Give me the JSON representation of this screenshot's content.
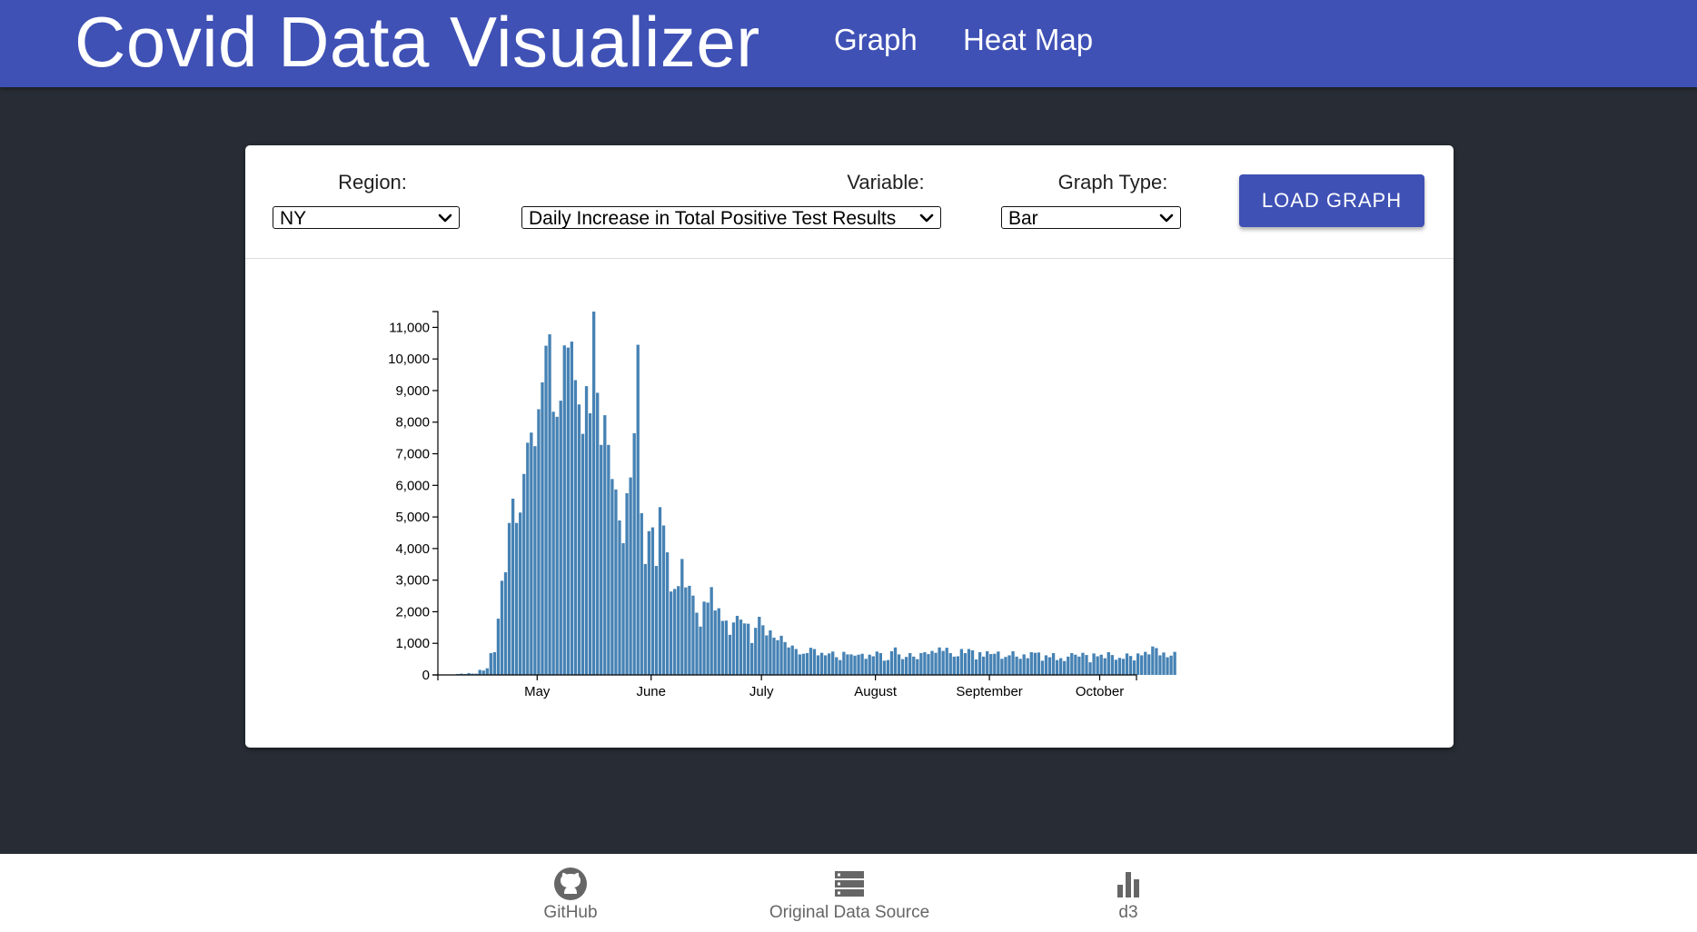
{
  "header": {
    "title": "Covid Data Visualizer",
    "nav": [
      {
        "label": "Graph"
      },
      {
        "label": "Heat Map"
      }
    ]
  },
  "controls": {
    "region": {
      "label": "Region:",
      "value": "NY"
    },
    "variable": {
      "label": "Variable:",
      "value": "Daily Increase in Total Positive Test Results"
    },
    "graph_type": {
      "label": "Graph Type:",
      "value": "Bar"
    },
    "load_button": "LOAD GRAPH"
  },
  "chart_data": {
    "type": "bar",
    "title": "",
    "xlabel": "",
    "ylabel": "",
    "bar_color": "#4682b4",
    "ylim": [
      0,
      11500
    ],
    "yticks": [
      0,
      1000,
      2000,
      3000,
      4000,
      5000,
      6000,
      7000,
      8000,
      9000,
      10000,
      11000
    ],
    "ytick_labels": [
      "0",
      "1,000",
      "2,000",
      "3,000",
      "4,000",
      "5,000",
      "6,000",
      "7,000",
      "8,000",
      "9,000",
      "10,000",
      "11,000"
    ],
    "x_start_date": "2020-04-04",
    "x_end_date": "2020-10-11",
    "xticks": [
      "May",
      "June",
      "July",
      "August",
      "September",
      "October"
    ],
    "xtick_dates": [
      "2020-05-01",
      "2020-06-01",
      "2020-07-01",
      "2020-08-01",
      "2020-09-01",
      "2020-10-01"
    ],
    "values": [
      30,
      40,
      30,
      60,
      40,
      40,
      160,
      140,
      210,
      690,
      720,
      1780,
      2980,
      3250,
      4810,
      5580,
      4810,
      5140,
      6360,
      7350,
      7670,
      7240,
      8410,
      9260,
      10420,
      10780,
      8330,
      8170,
      8680,
      10430,
      10360,
      10550,
      9330,
      8560,
      7630,
      9140,
      8280,
      11500,
      8930,
      7280,
      8220,
      7280,
      6200,
      5870,
      4890,
      4170,
      5750,
      6250,
      7650,
      10450,
      5120,
      3510,
      4550,
      4670,
      3450,
      5310,
      4730,
      3880,
      2640,
      2720,
      2810,
      3670,
      2770,
      2820,
      2510,
      1970,
      1530,
      2320,
      2290,
      2780,
      2040,
      2110,
      1710,
      1720,
      1270,
      1660,
      1870,
      1750,
      1630,
      1620,
      1010,
      1490,
      1840,
      1570,
      1250,
      1410,
      1180,
      1100,
      1240,
      1040,
      870,
      930,
      820,
      650,
      670,
      690,
      860,
      820,
      620,
      700,
      620,
      680,
      740,
      560,
      470,
      730,
      650,
      650,
      610,
      640,
      670,
      510,
      640,
      590,
      740,
      690,
      450,
      470,
      750,
      870,
      650,
      500,
      570,
      690,
      580,
      500,
      690,
      720,
      660,
      760,
      700,
      870,
      760,
      860,
      690,
      580,
      590,
      820,
      690,
      820,
      780,
      490,
      720,
      580,
      750,
      660,
      670,
      740,
      510,
      570,
      620,
      750,
      580,
      510,
      650,
      530,
      720,
      700,
      710,
      450,
      620,
      560,
      690,
      470,
      530,
      440,
      580,
      690,
      640,
      580,
      700,
      630,
      400,
      680,
      590,
      640,
      530,
      720,
      630,
      480,
      540,
      510,
      680,
      600,
      460,
      680,
      620,
      730,
      650,
      900,
      850,
      620,
      710,
      560,
      610,
      730
    ]
  },
  "footer": {
    "items": [
      {
        "label": "GitHub"
      },
      {
        "label": "Original Data Source"
      },
      {
        "label": "d3"
      }
    ]
  }
}
